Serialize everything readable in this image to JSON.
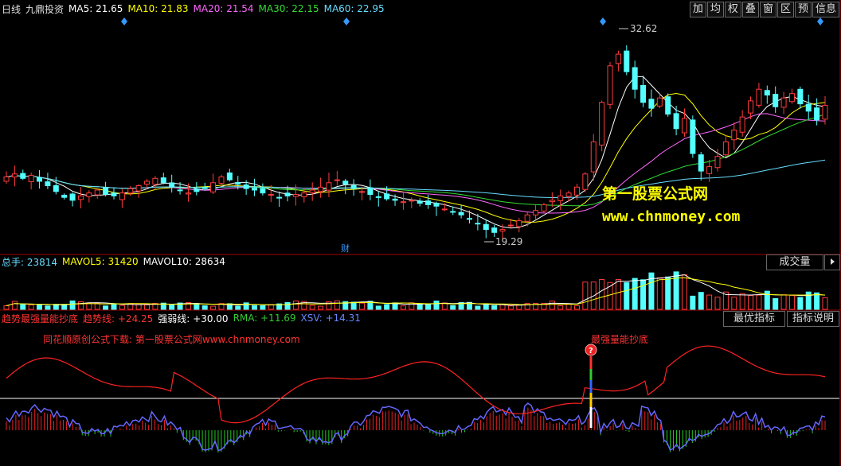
{
  "header": {
    "period": "日线",
    "stock": "九鼎投资",
    "ma": [
      {
        "label": "MA5: 21.65",
        "color": "#ffffff"
      },
      {
        "label": "MA10: 21.83",
        "color": "#ffff00"
      },
      {
        "label": "MA20: 21.54",
        "color": "#ff66ff"
      },
      {
        "label": "MA30: 22.15",
        "color": "#33dd33"
      },
      {
        "label": "MA60: 22.95",
        "color": "#66ddff"
      }
    ],
    "buttons": [
      "加",
      "均",
      "权",
      "叠",
      "窗",
      "区",
      "预",
      "信息"
    ]
  },
  "price": {
    "high_label": "32.62",
    "low_label": "19.29",
    "cai_label": "财"
  },
  "watermark": {
    "cn": "第一股票公式网",
    "url": "www.chnmoney.com"
  },
  "volume": {
    "legend": [
      {
        "label": "总手: 23814",
        "color": "#66ddff"
      },
      {
        "label": "MAVOL5: 31420",
        "color": "#ffff00"
      },
      {
        "label": "MAVOL10: 28634",
        "color": "#ffffff"
      }
    ],
    "tab": "成交量"
  },
  "indicator": {
    "legend": [
      {
        "label": "趋势最强量能抄底",
        "color": "#ff3333"
      },
      {
        "label": "趋势线: +24.25",
        "color": "#ff3333"
      },
      {
        "label": "强弱线: +30.00",
        "color": "#ffffff"
      },
      {
        "label": "RMA: +11.69",
        "color": "#33cc33"
      },
      {
        "label": "XSV: +14.31",
        "color": "#6688ff"
      }
    ],
    "btn_best": "最优指标",
    "btn_help": "指标说明",
    "note_left": "同花顺原创公式下载: 第一股票公式网www.chnmoney.com",
    "note_signal": "最强量能抄底"
  },
  "chart_data": {
    "type": "candlestick",
    "price_range": [
      18,
      34
    ],
    "high": 32.62,
    "low": 19.29,
    "closes": [
      23.2,
      23.4,
      23.1,
      23.3,
      22.9,
      22.6,
      22.2,
      21.8,
      21.6,
      21.9,
      22.1,
      22.3,
      22.0,
      21.9,
      22.1,
      22.4,
      22.6,
      22.9,
      23.1,
      22.8,
      22.5,
      22.3,
      22.1,
      22.2,
      22.4,
      22.8,
      23.2,
      23.0,
      22.7,
      22.4,
      22.3,
      22.1,
      22.0,
      21.8,
      21.9,
      22.0,
      22.1,
      22.3,
      22.5,
      22.8,
      23.0,
      22.7,
      22.4,
      22.2,
      22.0,
      21.8,
      21.7,
      21.6,
      21.5,
      21.6,
      21.4,
      21.3,
      21.2,
      21.0,
      20.8,
      20.6,
      20.3,
      20.0,
      19.6,
      19.4,
      19.6,
      19.9,
      20.2,
      20.6,
      20.9,
      21.3,
      21.6,
      21.9,
      22.1,
      22.5,
      23.4,
      25.6,
      28.3,
      30.8,
      31.6,
      30.4,
      29.2,
      28.3,
      27.9,
      28.6,
      27.5,
      26.5,
      27.2,
      24.8,
      23.6,
      23.9,
      24.6,
      25.6,
      26.4,
      27.3,
      28.4,
      29.2,
      28.8,
      28.0,
      28.6,
      28.9,
      28.2,
      27.7,
      27.1,
      28.1
    ]
  }
}
